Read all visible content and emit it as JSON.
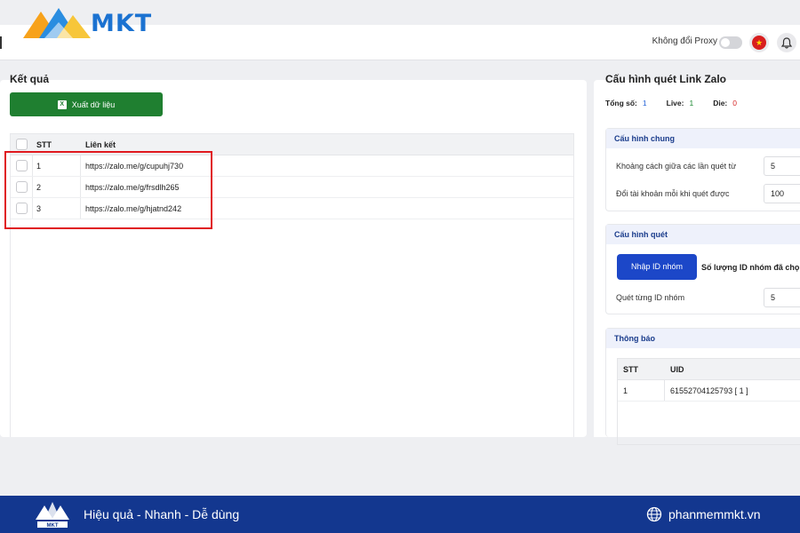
{
  "brand": {
    "logo_text": "MKT"
  },
  "topbar": {
    "proxy_label": "Không đổi Proxy"
  },
  "left": {
    "title": "Kết quả",
    "export_label": "Xuất dữ liệu",
    "columns": {
      "stt": "STT",
      "link": "Liên kết"
    },
    "rows": [
      {
        "stt": "1",
        "link": "https://zalo.me/g/cupuhj730"
      },
      {
        "stt": "2",
        "link": "https://zalo.me/g/frsdlh265"
      },
      {
        "stt": "3",
        "link": "https://zalo.me/g/hjatnd242"
      }
    ]
  },
  "right": {
    "title": "Cấu hình quét Link Zalo",
    "stats": {
      "total_label": "Tổng số:",
      "total": "1",
      "live_label": "Live:",
      "live": "1",
      "die_label": "Die:",
      "die": "0"
    },
    "general": {
      "title": "Cấu hình chung",
      "interval_label": "Khoảng cách giữa các lần quét từ",
      "interval_value": "5",
      "switch_label": "Đổi tài khoản mỗi khi quét được",
      "switch_value": "100"
    },
    "scan": {
      "title": "Cấu hình quét",
      "import_label": "Nhập ID nhóm",
      "count_label": "Số lượng ID nhóm đã chọn",
      "per_label": "Quét từng ID nhóm",
      "per_value": "5"
    },
    "notify": {
      "title": "Thông báo",
      "columns": {
        "stt": "STT",
        "uid": "UID"
      },
      "rows": [
        {
          "stt": "1",
          "uid": "61552704125793 [ 1 ]"
        }
      ]
    }
  },
  "footer": {
    "slogan": "Hiệu quả - Nhanh - Dễ dùng",
    "website": "phanmemmkt.vn"
  },
  "colors": {
    "export_green": "#1f7f30",
    "primary_blue": "#1c47c8",
    "footer_navy": "#13378f",
    "highlight_red": "#e0191f"
  }
}
